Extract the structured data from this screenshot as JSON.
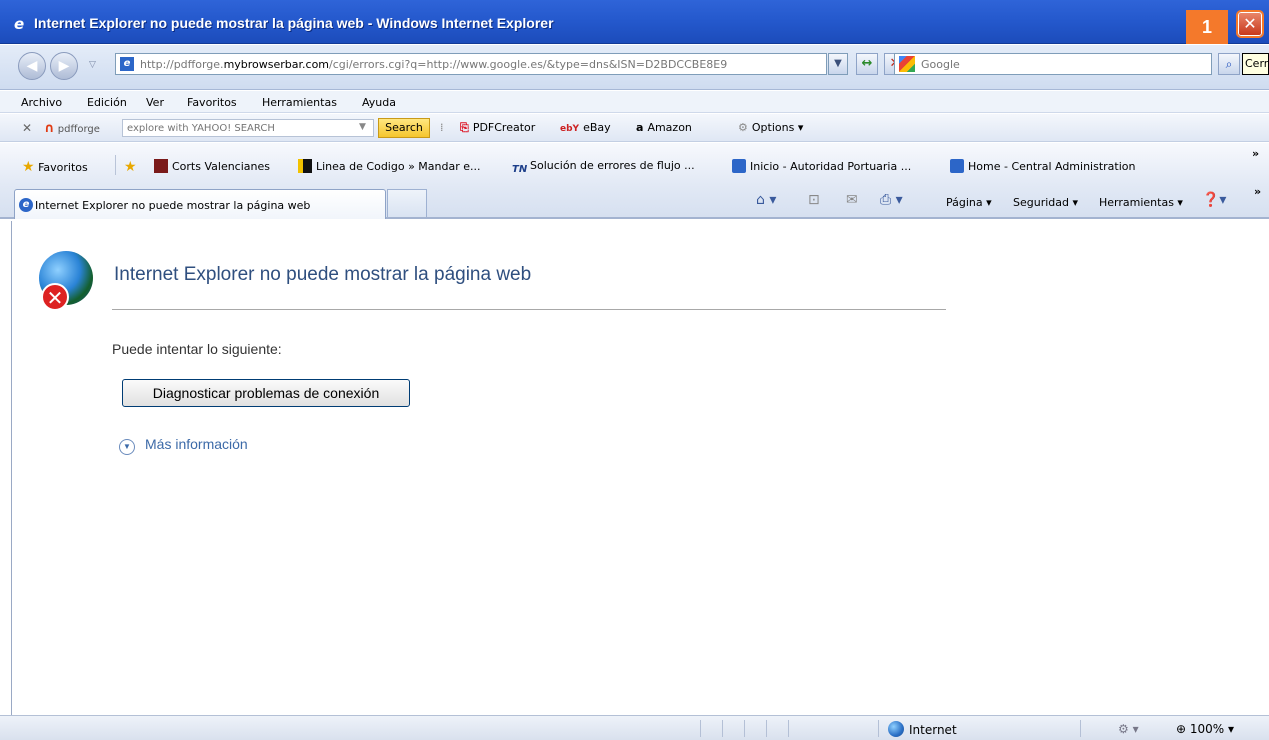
{
  "window": {
    "title": "Internet Explorer no puede mostrar la página web - Windows Internet Explorer",
    "step_badge": "1",
    "close_glyph": "✕"
  },
  "address_bar": {
    "url_prefix": "http://pdfforge.",
    "url_domain": "mybrowserbar.com",
    "url_suffix": "/cgi/errors.cgi?q=http://www.google.es/&type=dns&ISN=D2BDCCBE8E9",
    "search_placeholder": "Google",
    "tooltip": "Cerrar"
  },
  "menu": [
    "Archivo",
    "Edición",
    "Ver",
    "Favoritos",
    "Herramientas",
    "Ayuda"
  ],
  "toolbar": {
    "brand": "pdfforge",
    "search_placeholder": "explore with YAHOO! SEARCH",
    "search_button": "Search",
    "items": [
      "PDFCreator",
      "eBay",
      "Amazon",
      "Options"
    ]
  },
  "favorites": {
    "label": "Favoritos",
    "links": [
      "Corts Valencianes",
      "Linea de Codigo » Mandar e...",
      "Solución de errores de flujo ...",
      "Inicio - Autoridad Portuaria ...",
      "Home - Central Administration"
    ]
  },
  "tabs": {
    "active_title": "Internet Explorer no puede mostrar la página web"
  },
  "command_bar": {
    "page": "Página",
    "security": "Seguridad",
    "tools": "Herramientas"
  },
  "content": {
    "heading": "Internet Explorer no puede mostrar la página web",
    "try_text": "Puede intentar lo siguiente:",
    "diagnose_button": "Diagnosticar problemas de conexión",
    "more_info": "Más información"
  },
  "status_bar": {
    "zone": "Internet",
    "zoom": "100%"
  }
}
